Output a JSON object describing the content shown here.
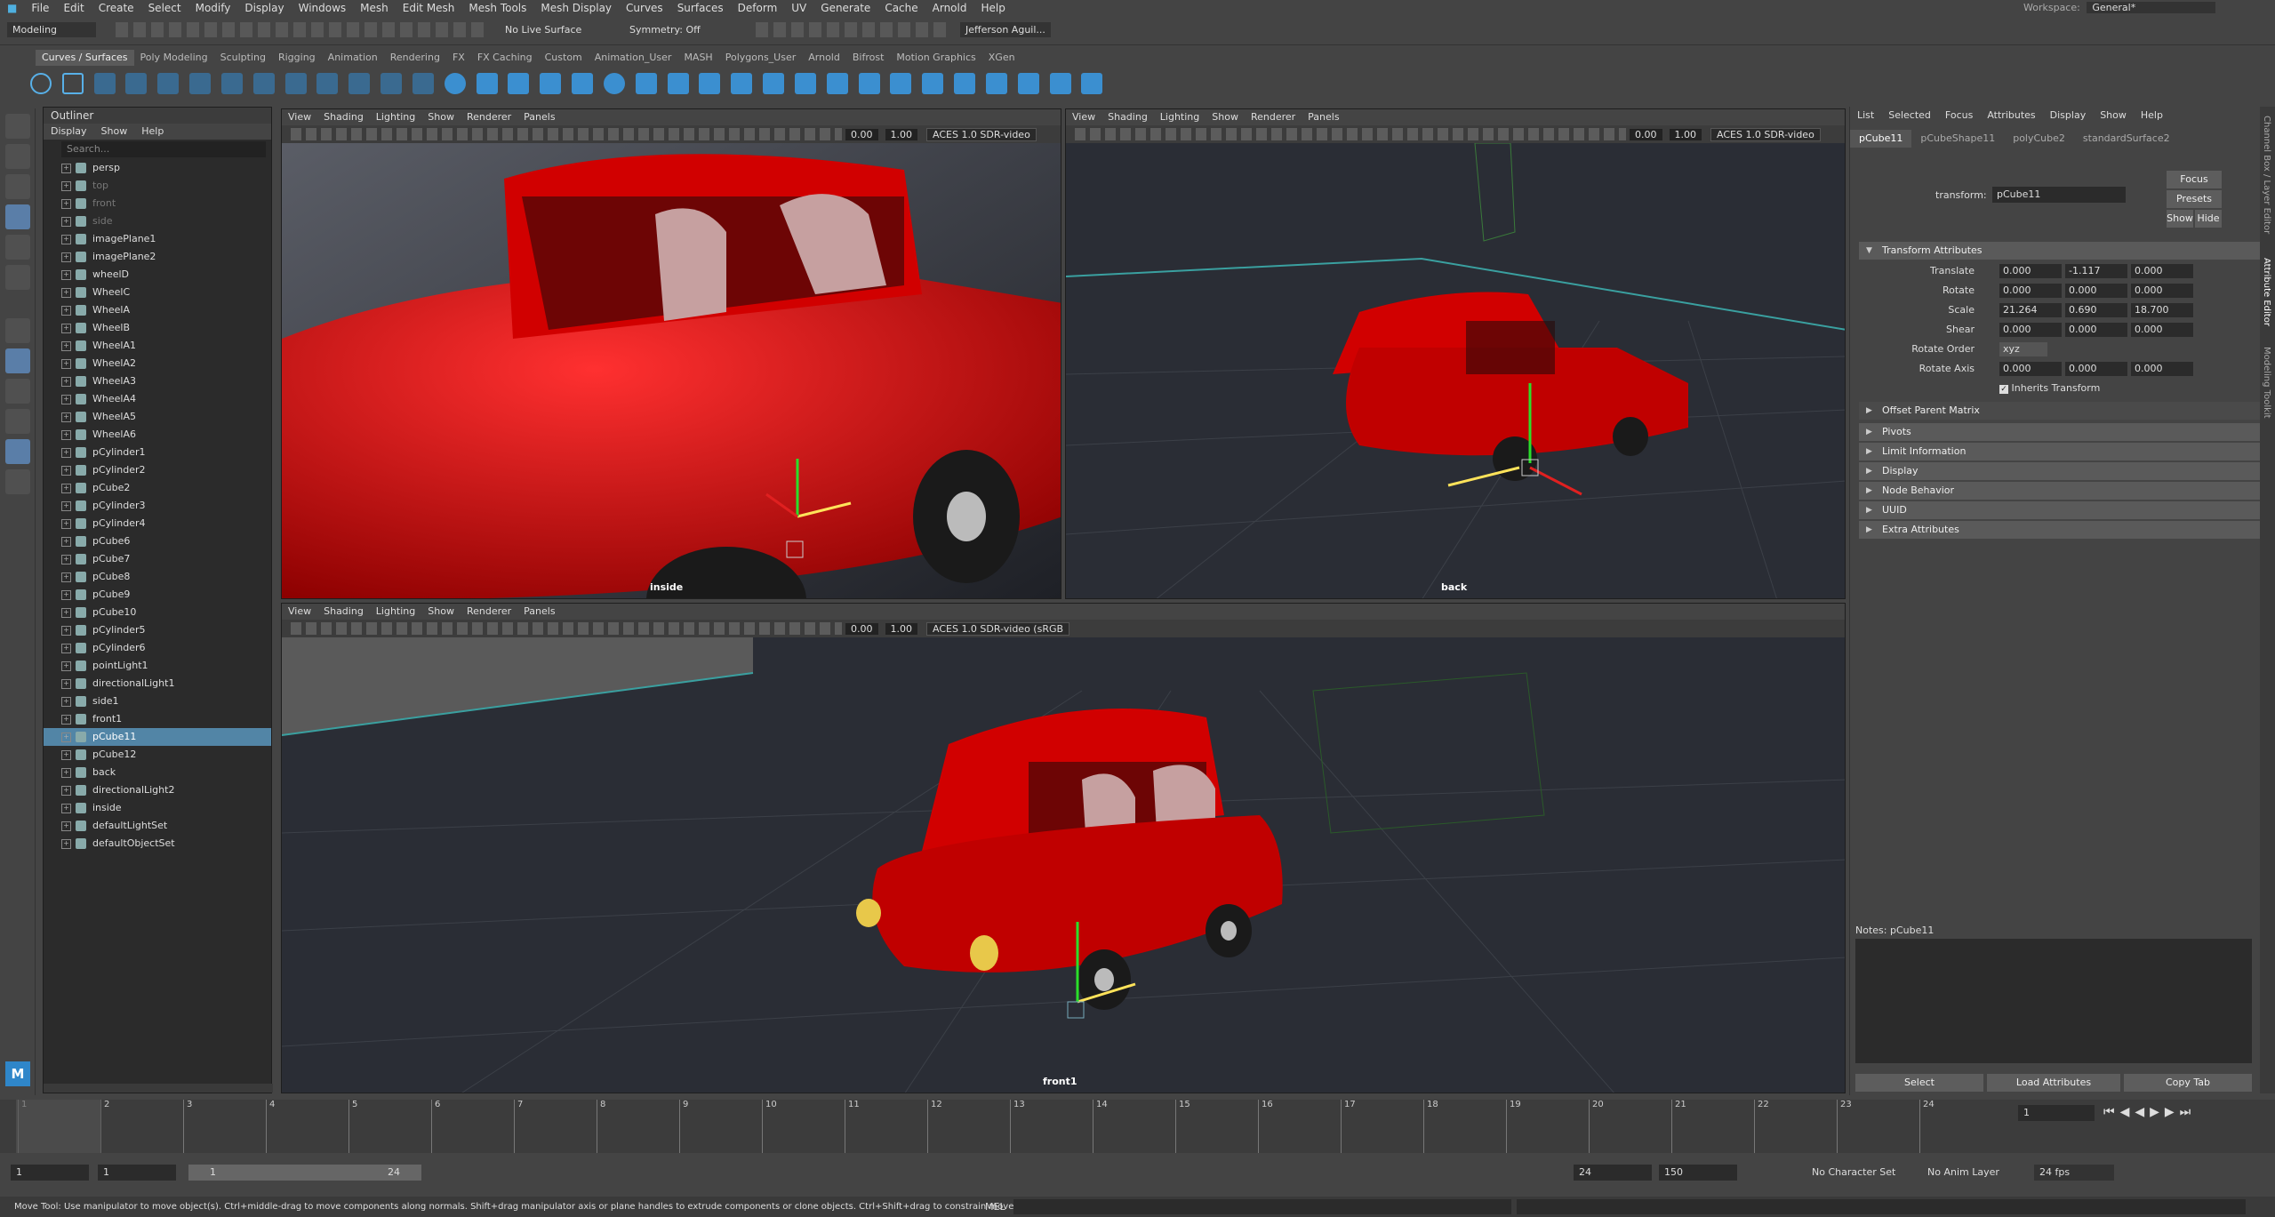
{
  "menubar": [
    "File",
    "Edit",
    "Create",
    "Select",
    "Modify",
    "Display",
    "Windows",
    "Mesh",
    "Edit Mesh",
    "Mesh Tools",
    "Mesh Display",
    "Curves",
    "Surfaces",
    "Deform",
    "UV",
    "Generate",
    "Cache",
    "Arnold",
    "Help"
  ],
  "workspace": {
    "label": "Workspace:",
    "value": "General*"
  },
  "statusline": {
    "mode": "Modeling",
    "live_surface": "No Live Surface",
    "symmetry": "Symmetry: Off",
    "user": "Jefferson Aguil..."
  },
  "shelf_tabs": [
    "Curves / Surfaces",
    "Poly Modeling",
    "Sculpting",
    "Rigging",
    "Animation",
    "Rendering",
    "FX",
    "FX Caching",
    "Custom",
    "Animation_User",
    "MASH",
    "Polygons_User",
    "Arnold",
    "Bifrost",
    "Motion Graphics",
    "XGen"
  ],
  "outliner": {
    "title": "Outliner",
    "menu": [
      "Display",
      "Show",
      "Help"
    ],
    "search_placeholder": "Search...",
    "items": [
      {
        "name": "persp",
        "dim": false
      },
      {
        "name": "top",
        "dim": true
      },
      {
        "name": "front",
        "dim": true
      },
      {
        "name": "side",
        "dim": true
      },
      {
        "name": "imagePlane1",
        "dim": false
      },
      {
        "name": "imagePlane2",
        "dim": false
      },
      {
        "name": "wheelD",
        "dim": false
      },
      {
        "name": "WheelC",
        "dim": false
      },
      {
        "name": "WheelA",
        "dim": false
      },
      {
        "name": "WheelB",
        "dim": false
      },
      {
        "name": "WheelA1",
        "dim": false
      },
      {
        "name": "WheelA2",
        "dim": false
      },
      {
        "name": "WheelA3",
        "dim": false
      },
      {
        "name": "WheelA4",
        "dim": false
      },
      {
        "name": "WheelA5",
        "dim": false
      },
      {
        "name": "WheelA6",
        "dim": false
      },
      {
        "name": "pCylinder1",
        "dim": false
      },
      {
        "name": "pCylinder2",
        "dim": false
      },
      {
        "name": "pCube2",
        "dim": false
      },
      {
        "name": "pCylinder3",
        "dim": false
      },
      {
        "name": "pCylinder4",
        "dim": false
      },
      {
        "name": "pCube6",
        "dim": false
      },
      {
        "name": "pCube7",
        "dim": false
      },
      {
        "name": "pCube8",
        "dim": false
      },
      {
        "name": "pCube9",
        "dim": false
      },
      {
        "name": "pCube10",
        "dim": false
      },
      {
        "name": "pCylinder5",
        "dim": false
      },
      {
        "name": "pCylinder6",
        "dim": false
      },
      {
        "name": "pointLight1",
        "dim": false
      },
      {
        "name": "directionalLight1",
        "dim": false
      },
      {
        "name": "side1",
        "dim": false
      },
      {
        "name": "front1",
        "dim": false
      },
      {
        "name": "pCube11",
        "dim": false,
        "selected": true
      },
      {
        "name": "pCube12",
        "dim": false
      },
      {
        "name": "back",
        "dim": false
      },
      {
        "name": "directionalLight2",
        "dim": false
      },
      {
        "name": "inside",
        "dim": false
      },
      {
        "name": "defaultLightSet",
        "dim": false
      },
      {
        "name": "defaultObjectSet",
        "dim": false
      }
    ]
  },
  "viewport": {
    "menu": [
      "View",
      "Shading",
      "Lighting",
      "Show",
      "Renderer",
      "Panels"
    ],
    "exposure": "0.00",
    "gamma": "1.00",
    "colorspace": "ACES 1.0 SDR-video",
    "colorspace_full": "ACES 1.0 SDR-video (sRGB",
    "panels": [
      {
        "label": "inside"
      },
      {
        "label": "back"
      },
      {
        "label": "front1"
      }
    ]
  },
  "attribute_editor": {
    "menu": [
      "List",
      "Selected",
      "Focus",
      "Attributes",
      "Display",
      "Show",
      "Help"
    ],
    "tabs": [
      "pCube11",
      "pCubeShape11",
      "polyCube2",
      "standardSurface2"
    ],
    "transform_label": "transform:",
    "transform_value": "pCube11",
    "buttons": {
      "focus": "Focus",
      "presets": "Presets",
      "show": "Show",
      "hide": "Hide"
    },
    "section_transform": "Transform Attributes",
    "translate": {
      "label": "Translate",
      "x": "0.000",
      "y": "-1.117",
      "z": "0.000"
    },
    "rotate": {
      "label": "Rotate",
      "x": "0.000",
      "y": "0.000",
      "z": "0.000"
    },
    "scale": {
      "label": "Scale",
      "x": "21.264",
      "y": "0.690",
      "z": "18.700"
    },
    "shear": {
      "label": "Shear",
      "x": "0.000",
      "y": "0.000",
      "z": "0.000"
    },
    "rotate_order": {
      "label": "Rotate Order",
      "value": "xyz"
    },
    "rotate_axis": {
      "label": "Rotate Axis",
      "x": "0.000",
      "y": "0.000",
      "z": "0.000"
    },
    "inherits": "Inherits Transform",
    "offset": "Offset Parent Matrix",
    "sections": [
      "Pivots",
      "Limit Information",
      "Display",
      "Node Behavior",
      "UUID",
      "Extra Attributes"
    ],
    "notes": "Notes:  pCube11",
    "bottom": {
      "select": "Select",
      "load": "Load Attributes",
      "copy": "Copy Tab"
    }
  },
  "side_tabs": [
    "Channel Box / Layer Editor",
    "Attribute Editor",
    "Modeling Toolkit"
  ],
  "timeline": {
    "ticks": [
      "1",
      "2",
      "3",
      "4",
      "5",
      "6",
      "7",
      "8",
      "9",
      "10",
      "11",
      "12",
      "13",
      "14",
      "15",
      "16",
      "17",
      "18",
      "19",
      "20",
      "21",
      "22",
      "23",
      "24"
    ],
    "current": "1"
  },
  "range": {
    "start": "1",
    "start2": "1",
    "slider_start": "1",
    "slider_end": "24",
    "end": "24",
    "end2": "150",
    "character_set": "No Character Set",
    "anim_layer": "No Anim Layer",
    "fps": "24 fps"
  },
  "status": {
    "message": "Move Tool: Use manipulator to move object(s). Ctrl+middle-drag to move components along normals. Shift+drag manipulator axis or plane handles to extrude components or clone objects. Ctrl+Shift+drag to constrain movement to a cor",
    "mel": "MEL"
  },
  "colors": {
    "car": "#d10000",
    "select": "#5285a6",
    "bg": "#444444"
  }
}
